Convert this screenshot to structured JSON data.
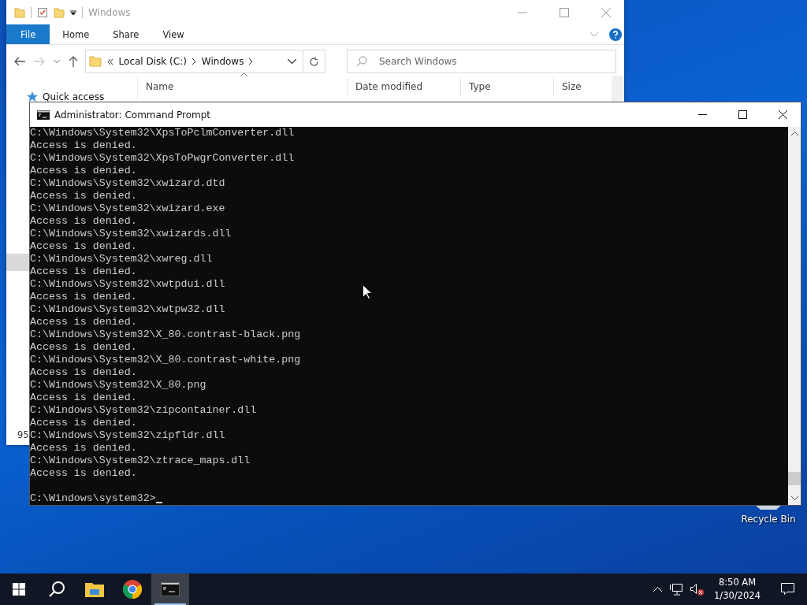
{
  "explorer": {
    "title": "Windows",
    "ribbon_tabs": [
      {
        "label": "File",
        "selected": true
      },
      {
        "label": "Home",
        "selected": false
      },
      {
        "label": "Share",
        "selected": false
      },
      {
        "label": "View",
        "selected": false
      }
    ],
    "address": [
      "Local Disk (C:)",
      "Windows"
    ],
    "search": {
      "placeholder": "Search Windows"
    },
    "columns": [
      "Name",
      "Date modified",
      "Type",
      "Size"
    ],
    "nav_items": [
      "Quick access"
    ],
    "status": "95"
  },
  "cmd": {
    "title": "Administrator: Command Prompt",
    "lines": [
      "C:\\Windows\\System32\\XpsToPclmConverter.dll",
      "Access is denied.",
      "C:\\Windows\\System32\\XpsToPwgrConverter.dll",
      "Access is denied.",
      "C:\\Windows\\System32\\xwizard.dtd",
      "Access is denied.",
      "C:\\Windows\\System32\\xwizard.exe",
      "Access is denied.",
      "C:\\Windows\\System32\\xwizards.dll",
      "Access is denied.",
      "C:\\Windows\\System32\\xwreg.dll",
      "Access is denied.",
      "C:\\Windows\\System32\\xwtpdui.dll",
      "Access is denied.",
      "C:\\Windows\\System32\\xwtpw32.dll",
      "Access is denied.",
      "C:\\Windows\\System32\\X_80.contrast-black.png",
      "Access is denied.",
      "C:\\Windows\\System32\\X_80.contrast-white.png",
      "Access is denied.",
      "C:\\Windows\\System32\\X_80.png",
      "Access is denied.",
      "C:\\Windows\\System32\\zipcontainer.dll",
      "Access is denied.",
      "C:\\Windows\\System32\\zipfldr.dll",
      "Access is denied.",
      "C:\\Windows\\System32\\ztrace_maps.dll",
      "Access is denied."
    ],
    "prompt": "C:\\Windows\\system32>"
  },
  "desktop_icons": [
    {
      "label": "Recycle Bin"
    }
  ],
  "taskbar": {
    "apps": [
      {
        "kind": "explorer",
        "selected": false
      },
      {
        "kind": "chrome",
        "selected": false
      },
      {
        "kind": "terminal",
        "selected": true
      }
    ],
    "time": "8:50 AM",
    "date": "1/30/2024"
  }
}
